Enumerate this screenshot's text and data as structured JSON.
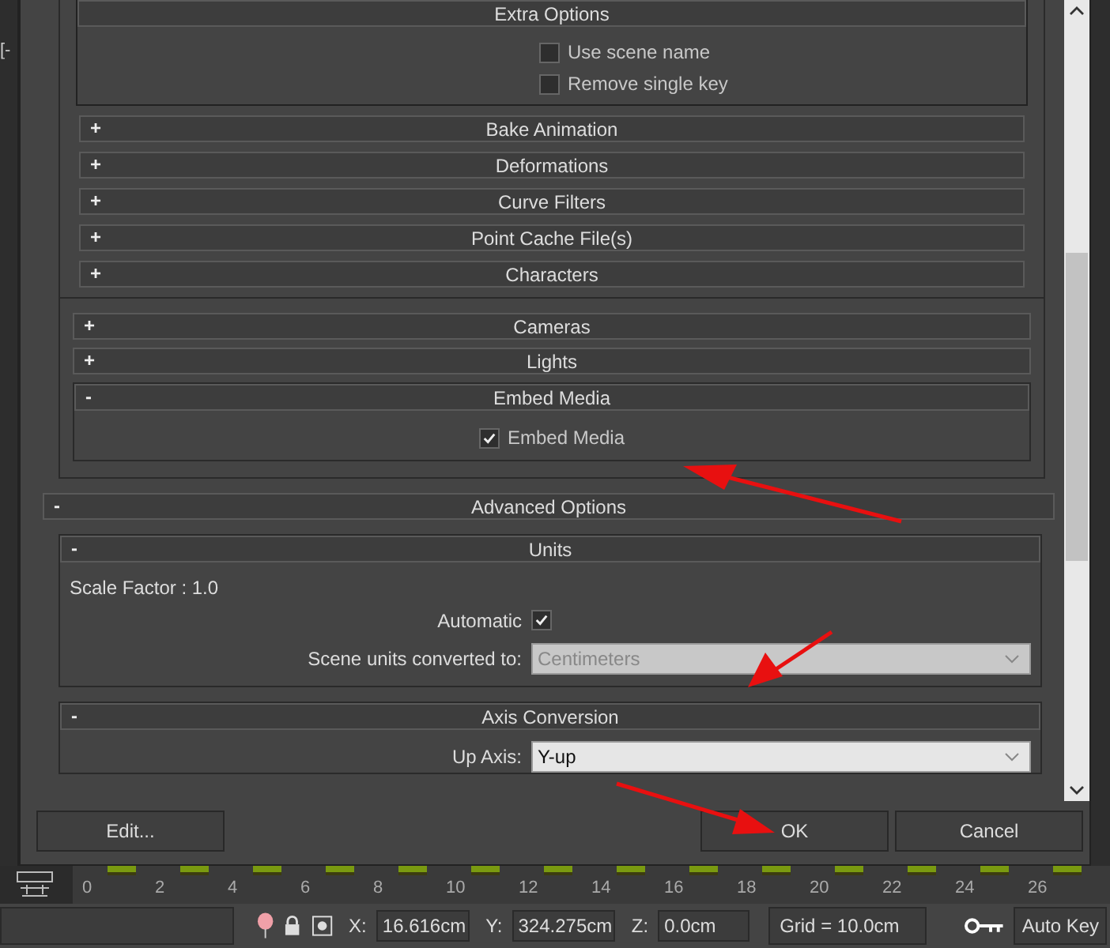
{
  "viewport": {
    "label": "[-"
  },
  "export_panel": {
    "extra_options": {
      "title": "Extra Options",
      "checkboxes": [
        {
          "label": "Use scene name",
          "checked": false
        },
        {
          "label": "Remove single key",
          "checked": false
        }
      ]
    },
    "rollouts": [
      {
        "toggle": "+",
        "title": "Bake Animation"
      },
      {
        "toggle": "+",
        "title": "Deformations"
      },
      {
        "toggle": "+",
        "title": "Curve Filters"
      },
      {
        "toggle": "+",
        "title": "Point Cache File(s)"
      },
      {
        "toggle": "+",
        "title": "Characters"
      }
    ],
    "sections": [
      {
        "toggle": "+",
        "title": "Cameras"
      },
      {
        "toggle": "+",
        "title": "Lights"
      },
      {
        "toggle": "-",
        "title": "Embed Media",
        "checkbox": {
          "label": "Embed Media",
          "checked": true
        }
      }
    ]
  },
  "advanced_options": {
    "toggle": "-",
    "title": "Advanced Options",
    "units": {
      "toggle": "-",
      "title": "Units",
      "scale_factor": "Scale Factor : 1.0",
      "automatic": {
        "label": "Automatic",
        "checked": true
      },
      "scene_units": {
        "label": "Scene units converted to:",
        "value": "Centimeters",
        "disabled": true
      }
    },
    "axis_conversion": {
      "toggle": "-",
      "title": "Axis Conversion",
      "up_axis": {
        "label": "Up Axis:",
        "value": "Y-up",
        "disabled": false
      }
    }
  },
  "buttons": [
    {
      "label": "Edit..."
    },
    {
      "label": "OK"
    },
    {
      "label": "Cancel"
    }
  ],
  "timeline": {
    "ticks": [
      "0",
      "2",
      "4",
      "6",
      "8",
      "10",
      "12",
      "14",
      "16",
      "18",
      "20",
      "22",
      "24",
      "26"
    ]
  },
  "status_bar": {
    "coords": [
      {
        "label": "X:",
        "value": "16.616cm"
      },
      {
        "label": "Y:",
        "value": "324.275cm"
      },
      {
        "label": "Z:",
        "value": "0.0cm"
      }
    ],
    "grid": "Grid = 10.0cm",
    "auto_key": "Auto Key"
  }
}
